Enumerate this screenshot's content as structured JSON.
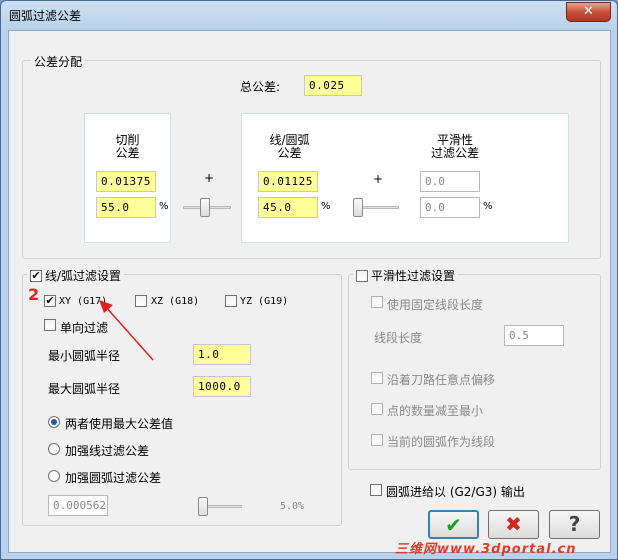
{
  "window": {
    "title": "圆弧过滤公差",
    "close_glyph": "✕"
  },
  "tolerance_group": {
    "label": "公差分配",
    "total_label": "总公差:",
    "total_value": "0.025",
    "cut": {
      "title_line1": "切削",
      "title_line2": "公差",
      "value": "0.01375",
      "percent": "55.0",
      "pct_sign": "%"
    },
    "line_arc": {
      "title_line1": "线/圆弧",
      "title_line2": "公差",
      "value": "0.01125",
      "percent": "45.0",
      "pct_sign": "%"
    },
    "smooth": {
      "title_line1": "平滑性",
      "title_line2": "过滤公差",
      "value": "0.0",
      "percent": "0.0",
      "pct_sign": "%"
    },
    "plus1": "+",
    "plus2": "+"
  },
  "line_arc_filter": {
    "label": "线/弧过滤设置",
    "checked": true,
    "annotation_number": "2",
    "planes": [
      {
        "label": "XY (G17)",
        "checked": true
      },
      {
        "label": "XZ (G18)",
        "checked": false
      },
      {
        "label": "YZ (G19)",
        "checked": false
      }
    ],
    "one_way_label": "单向过滤",
    "min_radius_label": "最小圆弧半径",
    "min_radius_value": "1.0",
    "max_radius_label": "最大圆弧半径",
    "max_radius_value": "1000.0",
    "radios": [
      {
        "label": "两者使用最大公差值",
        "selected": true
      },
      {
        "label": "加强线过滤公差",
        "selected": false
      },
      {
        "label": "加强圆弧过滤公差",
        "selected": false
      }
    ],
    "bottom_value": "0.000562",
    "bottom_percent": "5.0%"
  },
  "smooth_filter": {
    "label": "平滑性过滤设置",
    "checked": false,
    "fixed_segment_label": "使用固定线段长度",
    "segment_length_label": "线段长度",
    "segment_length_value": "0.5",
    "offset_label": "沿着刀路任意点偏移",
    "minimize_label": "点的数量减至最小",
    "arc_as_segment_label": "当前的圆弧作为线段"
  },
  "output_option": {
    "label": "圆弧进给以 (G2/G3) 输出",
    "checked": false
  },
  "buttons": {
    "ok_glyph": "✔",
    "cancel_glyph": "✖",
    "help_glyph": "?"
  },
  "watermark": "三维网www.3dportal.cn",
  "colors": {
    "ok": "#1aa21a",
    "cancel": "#d0281c",
    "annotation": "#e02020"
  }
}
